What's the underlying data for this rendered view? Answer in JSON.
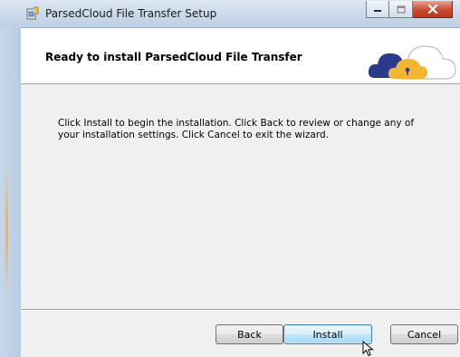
{
  "window": {
    "title": "ParsedCloud File Transfer Setup"
  },
  "header": {
    "title": "Ready to install ParsedCloud File Transfer",
    "logo_icon": "cloud-lock-icon"
  },
  "body": {
    "description": "Click Install to begin the installation. Click Back to review or change any of your installation settings. Click Cancel to exit the wizard."
  },
  "buttons": {
    "back": "Back",
    "install": "Install",
    "cancel": "Cancel"
  },
  "colors": {
    "logo_navy": "#2d3a8c",
    "logo_gold": "#f2b632",
    "close_red": "#c94a2f",
    "default_button_border": "#3c7fb1"
  }
}
